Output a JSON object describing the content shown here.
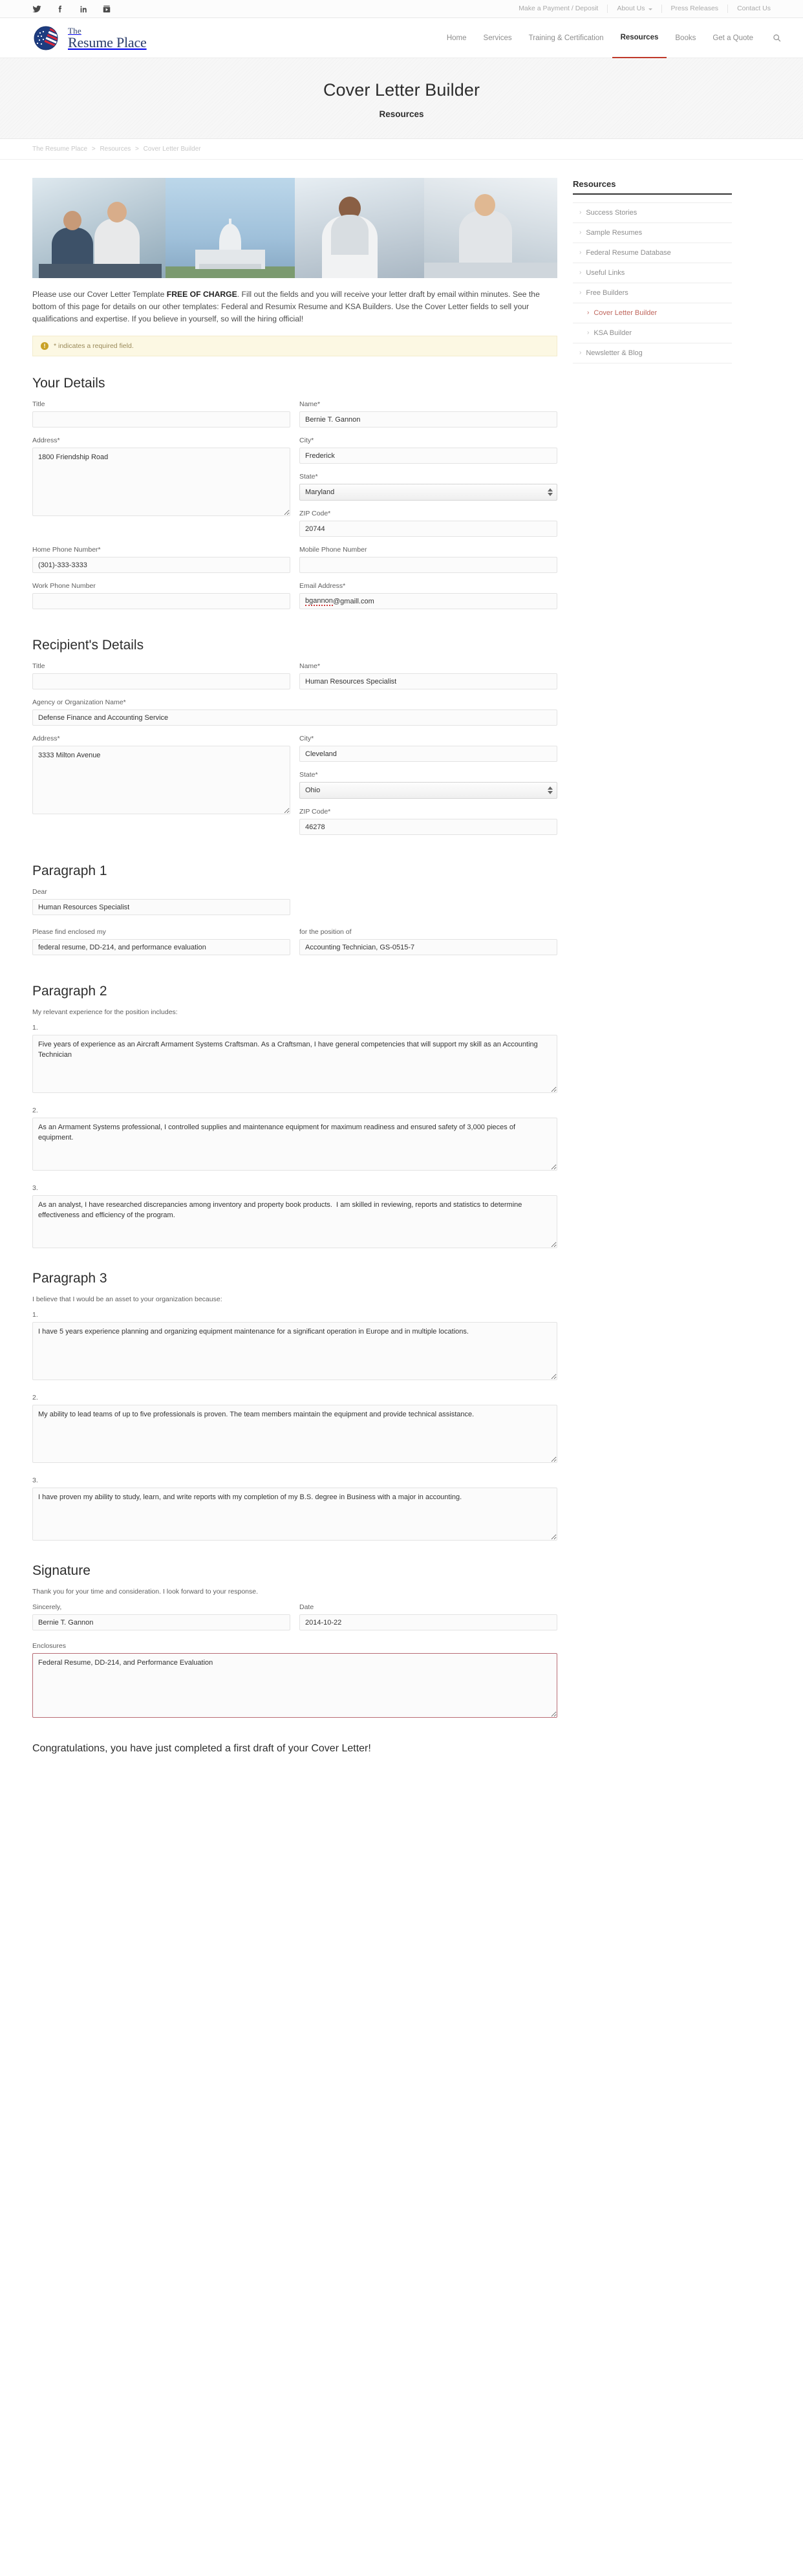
{
  "utility": {
    "social": [
      {
        "name": "twitter-icon",
        "label": "Twitter"
      },
      {
        "name": "facebook-icon",
        "label": "Facebook"
      },
      {
        "name": "linkedin-icon",
        "label": "LinkedIn"
      },
      {
        "name": "youtube-icon",
        "label": "YouTube"
      }
    ],
    "links": [
      {
        "label": "Make a Payment / Deposit",
        "caret": false
      },
      {
        "label": "About Us",
        "caret": true
      },
      {
        "label": "Press Releases",
        "caret": false
      },
      {
        "label": "Contact Us",
        "caret": false
      }
    ]
  },
  "brand": {
    "the": "The",
    "name": "Resume Place",
    "logo_icon": "globe-flag-icon"
  },
  "nav": {
    "items": [
      {
        "label": "Home",
        "active": false
      },
      {
        "label": "Services",
        "active": false
      },
      {
        "label": "Training & Certification",
        "active": false
      },
      {
        "label": "Resources",
        "active": true
      },
      {
        "label": "Books",
        "active": false
      },
      {
        "label": "Get a Quote",
        "active": false
      }
    ],
    "search_icon": "search-icon"
  },
  "banner": {
    "title": "Cover Letter Builder",
    "subtitle": "Resources"
  },
  "breadcrumb": {
    "items": [
      "The Resume Place",
      "Resources",
      "Cover Letter Builder"
    ],
    "separator": ">"
  },
  "intro": {
    "before_bold": "Please use our Cover Letter Template ",
    "bold": "FREE OF CHARGE",
    "after_bold": ". Fill out the fields and you will receive your letter draft by email within minutes. See the bottom of this page for details on our other templates: Federal and Resumix Resume and KSA Builders. Use the Cover Letter fields to sell your qualifications and expertise. If you believe in yourself, so will the hiring official!"
  },
  "notice": {
    "icon": "exclamation-icon",
    "glyph": "!",
    "text": "* indicates a required field."
  },
  "your_details": {
    "heading": "Your Details",
    "title_label": "Title",
    "title_value": "",
    "name_label": "Name*",
    "name_value": "Bernie T. Gannon",
    "address_label": "Address*",
    "address_value": "1800 Friendship Road",
    "city_label": "City*",
    "city_value": "Frederick",
    "state_label": "State*",
    "state_value": "Maryland",
    "zip_label": "ZIP Code*",
    "zip_value": "20744",
    "home_phone_label": "Home Phone Number*",
    "home_phone_value": "(301)-333-3333",
    "mobile_phone_label": "Mobile Phone Number",
    "mobile_phone_value": "",
    "work_phone_label": "Work Phone Number",
    "work_phone_value": "",
    "email_label": "Email Address*",
    "email_value_misspelled": "bgannon",
    "email_value_rest": "@gmaill.com"
  },
  "recipient_details": {
    "heading": "Recipient's Details",
    "title_label": "Title",
    "title_value": "",
    "name_label": "Name*",
    "name_value": "Human Resources Specialist",
    "agency_label": "Agency or Organization Name*",
    "agency_value": "Defense Finance and Accounting Service",
    "address_label": "Address*",
    "address_value": "3333 Milton Avenue",
    "city_label": "City*",
    "city_value": "Cleveland",
    "state_label": "State*",
    "state_value": "Ohio",
    "zip_label": "ZIP Code*",
    "zip_value": "46278"
  },
  "paragraph1": {
    "heading": "Paragraph 1",
    "dear_label": "Dear",
    "dear_value": "Human Resources Specialist",
    "enclosed_label": "Please find enclosed my",
    "enclosed_value": "federal resume, DD-214, and performance evaluation",
    "position_label": "for the position of",
    "position_value": "Accounting Technician, GS-0515-7"
  },
  "paragraph2": {
    "heading": "Paragraph 2",
    "helper": "My relevant experience for the position includes:",
    "items": [
      {
        "num": "1.",
        "value": "Five years of experience as an Aircraft Armament Systems Craftsman. As a Craftsman, I have general competencies that will support my skill as an Accounting Technician"
      },
      {
        "num": "2.",
        "value": "As an Armament Systems professional, I controlled supplies and maintenance equipment for maximum readiness and ensured safety of 3,000 pieces of equipment."
      },
      {
        "num": "3.",
        "value": "As an analyst, I have researched discrepancies among inventory and property book products.  I am skilled in reviewing, reports and statistics to determine effectiveness and efficiency of the program."
      }
    ]
  },
  "paragraph3": {
    "heading": "Paragraph 3",
    "helper": "I believe that I would be an asset to your organization because:",
    "items": [
      {
        "num": "1.",
        "value": "I have 5 years experience planning and organizing equipment maintenance for a significant operation in Europe and in multiple locations."
      },
      {
        "num": "2.",
        "value": "My ability to lead teams of up to five professionals is proven. The team members maintain the equipment and provide technical assistance."
      },
      {
        "num": "3.",
        "value": "I have proven my ability to study, learn, and write reports with my completion of my B.S. degree in Business with a major in accounting."
      }
    ]
  },
  "signature": {
    "heading": "Signature",
    "helper": "Thank you for your time and consideration. I look forward to your response.",
    "sincerely_label": "Sincerely,",
    "sincerely_value": "Bernie T. Gannon",
    "date_label": "Date",
    "date_value": "2014-10-22",
    "enclosures_label": "Enclosures",
    "enclosures_value": "Federal Resume, DD-214, and Performance Evaluation"
  },
  "closing": {
    "text": "Congratulations, you have just completed a first draft of your Cover Letter!"
  },
  "sidebar": {
    "title": "Resources",
    "items": [
      {
        "label": "Success Stories",
        "child": false,
        "active": false
      },
      {
        "label": "Sample Resumes",
        "child": false,
        "active": false
      },
      {
        "label": "Federal Resume Database",
        "child": false,
        "active": false
      },
      {
        "label": "Useful Links",
        "child": false,
        "active": false
      },
      {
        "label": "Free Builders",
        "child": false,
        "active": false
      },
      {
        "label": "Cover Letter Builder",
        "child": true,
        "active": true
      },
      {
        "label": "KSA Builder",
        "child": true,
        "active": false
      },
      {
        "label": "Newsletter & Blog",
        "child": false,
        "active": false
      }
    ],
    "chevron": "›"
  },
  "colors": {
    "accent_red": "#c0392b",
    "active_link": "#c0685f",
    "notice_bg": "#fcf8e3",
    "brand_navy": "#2b3d6b"
  }
}
